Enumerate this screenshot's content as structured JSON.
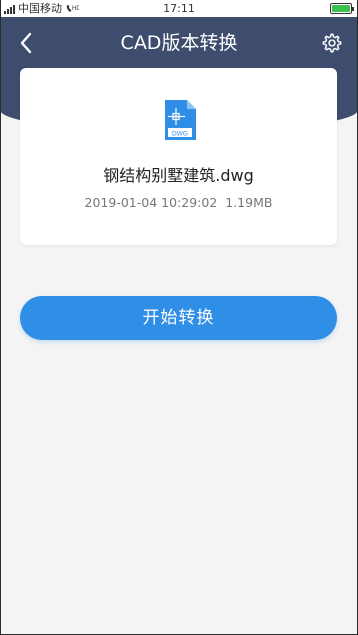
{
  "status_bar": {
    "carrier": "中国移动",
    "time": "17:11",
    "battery_level": 1.0,
    "battery_color": "#3cc04f"
  },
  "header": {
    "title": "CAD版本转换",
    "back_icon": "chevron-left-icon",
    "settings_icon": "gear-icon",
    "background_color": "#3e4d6e"
  },
  "file": {
    "icon": "dwg-file-icon",
    "icon_label": "DWG",
    "name": "钢结构别墅建筑.dwg",
    "date": "2019-01-04 10:29:02",
    "size": "1.19MB"
  },
  "actions": {
    "convert_label": "开始转换",
    "accent_color": "#2f8ee6"
  }
}
